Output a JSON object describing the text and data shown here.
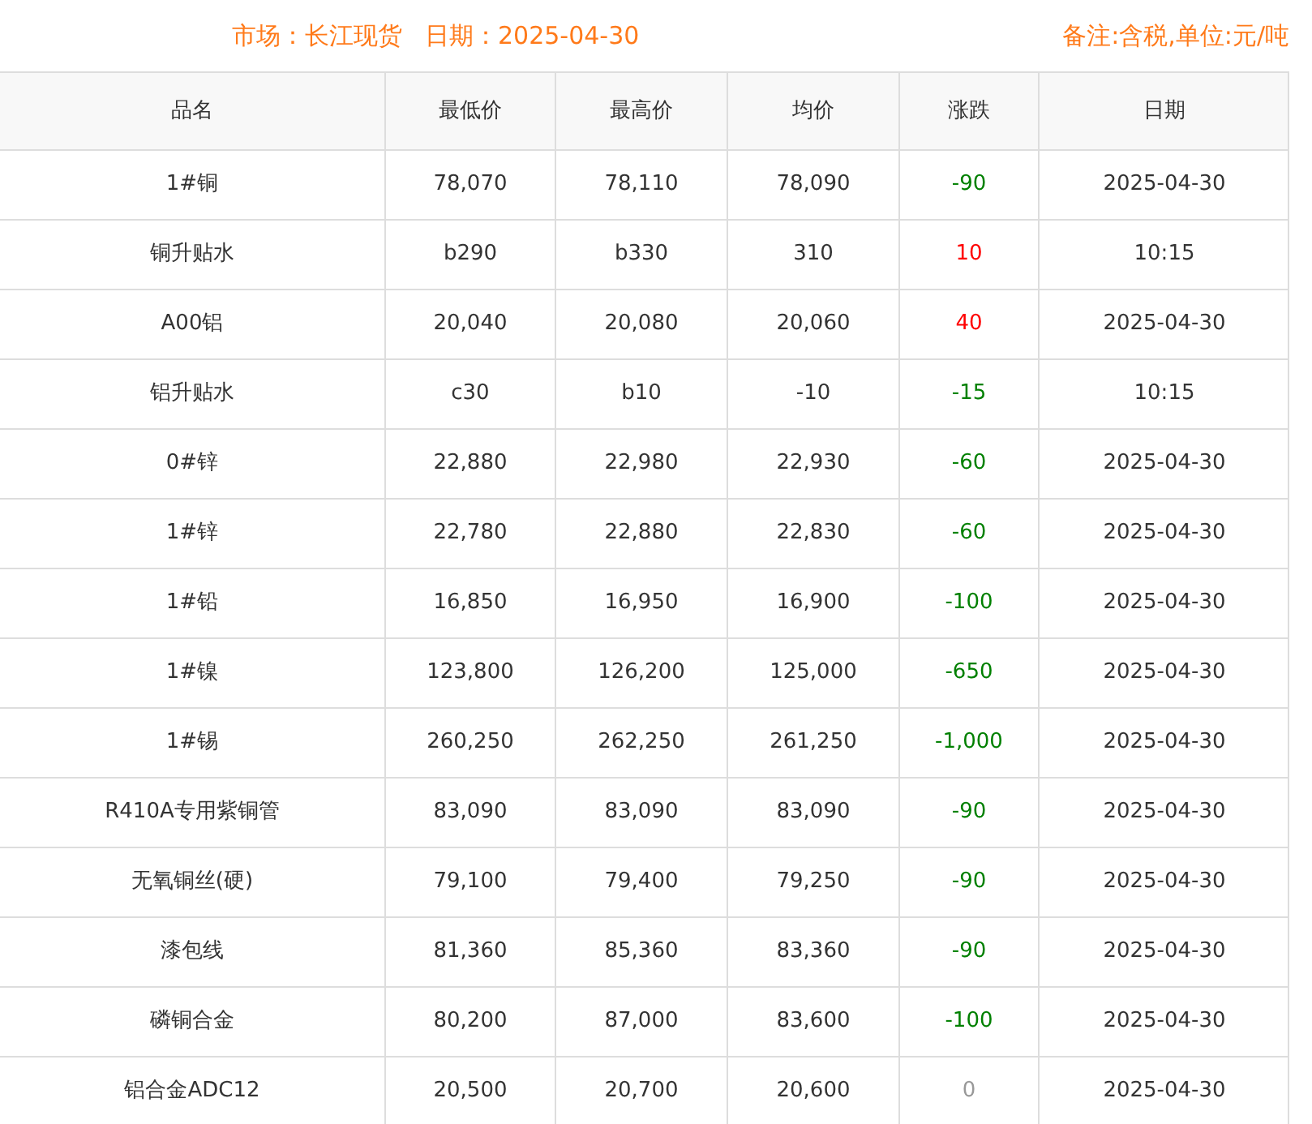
{
  "header": {
    "market": "市场：长江现货",
    "date": "日期：2025-04-30",
    "note": "备注:含税,单位:元/吨"
  },
  "table": {
    "columns": [
      "品名",
      "最低价",
      "最高价",
      "均价",
      "涨跌",
      "日期"
    ],
    "rows": [
      {
        "name": "1#铜",
        "low": "78,070",
        "high": "78,110",
        "avg": "78,090",
        "change": "-90",
        "color": "#008000",
        "date": "2025-04-30"
      },
      {
        "name": "铜升贴水",
        "low": "b290",
        "high": "b330",
        "avg": "310",
        "change": "10",
        "color": "#ff0000",
        "date": "10:15"
      },
      {
        "name": "A00铝",
        "low": "20,040",
        "high": "20,080",
        "avg": "20,060",
        "change": "40",
        "color": "#ff0000",
        "date": "2025-04-30"
      },
      {
        "name": "铝升贴水",
        "low": "c30",
        "high": "b10",
        "avg": "-10",
        "change": "-15",
        "color": "#008000",
        "date": "10:15"
      },
      {
        "name": "0#锌",
        "low": "22,880",
        "high": "22,980",
        "avg": "22,930",
        "change": "-60",
        "color": "#008000",
        "date": "2025-04-30"
      },
      {
        "name": "1#锌",
        "low": "22,780",
        "high": "22,880",
        "avg": "22,830",
        "change": "-60",
        "color": "#008000",
        "date": "2025-04-30"
      },
      {
        "name": "1#铅",
        "low": "16,850",
        "high": "16,950",
        "avg": "16,900",
        "change": "-100",
        "color": "#008000",
        "date": "2025-04-30"
      },
      {
        "name": "1#镍",
        "low": "123,800",
        "high": "126,200",
        "avg": "125,000",
        "change": "-650",
        "color": "#008000",
        "date": "2025-04-30"
      },
      {
        "name": "1#锡",
        "low": "260,250",
        "high": "262,250",
        "avg": "261,250",
        "change": "-1,000",
        "color": "#008000",
        "date": "2025-04-30"
      },
      {
        "name": "R410A专用紫铜管",
        "low": "83,090",
        "high": "83,090",
        "avg": "83,090",
        "change": "-90",
        "color": "#008000",
        "date": "2025-04-30"
      },
      {
        "name": "无氧铜丝(硬)",
        "low": "79,100",
        "high": "79,400",
        "avg": "79,250",
        "change": "-90",
        "color": "#008000",
        "date": "2025-04-30"
      },
      {
        "name": "漆包线",
        "low": "81,360",
        "high": "85,360",
        "avg": "83,360",
        "change": "-90",
        "color": "#008000",
        "date": "2025-04-30"
      },
      {
        "name": "磷铜合金",
        "low": "80,200",
        "high": "87,000",
        "avg": "83,600",
        "change": "-100",
        "color": "#008000",
        "date": "2025-04-30"
      },
      {
        "name": "铝合金ADC12",
        "low": "20,500",
        "high": "20,700",
        "avg": "20,600",
        "change": "0",
        "color": "#999999",
        "date": "2025-04-30"
      }
    ]
  }
}
